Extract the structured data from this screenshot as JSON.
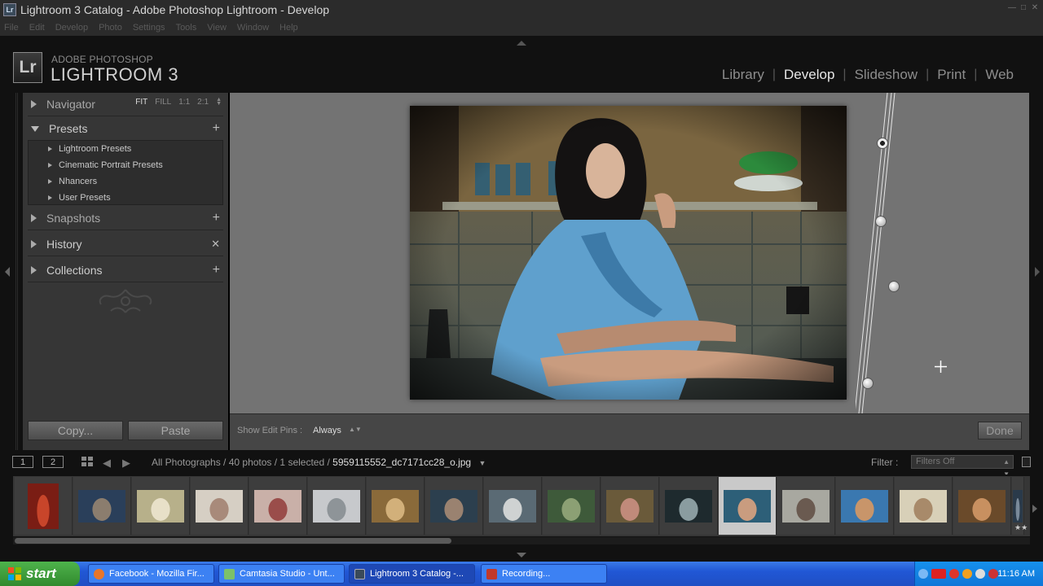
{
  "window": {
    "title": "Lightroom 3 Catalog - Adobe Photoshop Lightroom - Develop"
  },
  "menu": [
    "File",
    "Edit",
    "Develop",
    "Photo",
    "Settings",
    "Tools",
    "View",
    "Window",
    "Help"
  ],
  "logo": {
    "icon": "Lr",
    "small": "ADOBE PHOTOSHOP",
    "big": "LIGHTROOM 3"
  },
  "modules": [
    "Library",
    "Develop",
    "Slideshow",
    "Print",
    "Web"
  ],
  "active_module": "Develop",
  "left_panel": {
    "navigator": {
      "label": "Navigator",
      "zoom": [
        "FIT",
        "FILL",
        "1:1",
        "2:1"
      ]
    },
    "presets": {
      "label": "Presets",
      "items": [
        "Lightroom Presets",
        "Cinematic Portrait Presets",
        "Nhancers",
        "User Presets"
      ]
    },
    "snapshots": {
      "label": "Snapshots"
    },
    "history": {
      "label": "History"
    },
    "collections": {
      "label": "Collections"
    },
    "copy_label": "Copy...",
    "paste_label": "Paste"
  },
  "toolbar": {
    "pins_label": "Show Edit Pins :",
    "pins_value": "Always",
    "done_label": "Done"
  },
  "filmstrip": {
    "monitors": [
      "1",
      "2"
    ],
    "source": "All Photographs / 40 photos / 1 selected /",
    "filename": "5959115552_dc7171cc28_o.jpg",
    "filter_label": "Filter :",
    "filter_value": "Filters Off",
    "selected_index": 12,
    "rating_stars": "★★"
  },
  "taskbar": {
    "start_label": "start",
    "buttons": [
      "Facebook - Mozilla Fir...",
      "Camtasia Studio - Unt...",
      "Lightroom 3 Catalog -...",
      "Recording..."
    ],
    "clock": "11:16 AM"
  },
  "colors": {
    "accent_active": "#e6e6e6",
    "panel": "#363636",
    "canvas": "#737373"
  }
}
